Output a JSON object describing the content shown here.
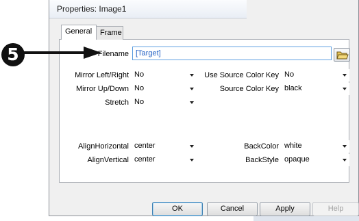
{
  "dialog": {
    "title": "Properties: Image1"
  },
  "tabs": [
    {
      "label": "General",
      "active": true
    },
    {
      "label": "Frame",
      "active": false
    }
  ],
  "filename": {
    "label": "Filename",
    "value": "[Target]",
    "browse_icon": "folder-open-icon"
  },
  "left_fields": [
    {
      "label": "Mirror Left/Right",
      "value": "No"
    },
    {
      "label": "Mirror Up/Down",
      "value": "No"
    },
    {
      "label": "Stretch",
      "value": "No"
    }
  ],
  "right_fields": [
    {
      "label": "Use Source Color Key",
      "value": "No"
    },
    {
      "label": "Source Color Key",
      "value": "black"
    }
  ],
  "align_fields": [
    {
      "label": "AlignHorizontal",
      "value": "center"
    },
    {
      "label": "AlignVertical",
      "value": "center"
    }
  ],
  "back_fields": [
    {
      "label": "BackColor",
      "value": "white"
    },
    {
      "label": "BackStyle",
      "value": "opaque"
    }
  ],
  "buttons": {
    "ok": "OK",
    "cancel": "Cancel",
    "apply": "Apply",
    "help": "Help"
  },
  "annotation": {
    "number": "5"
  },
  "colors": {
    "accent": "#5c9ee0",
    "value_text": "#1f5fc4",
    "annotation": "#111111"
  }
}
